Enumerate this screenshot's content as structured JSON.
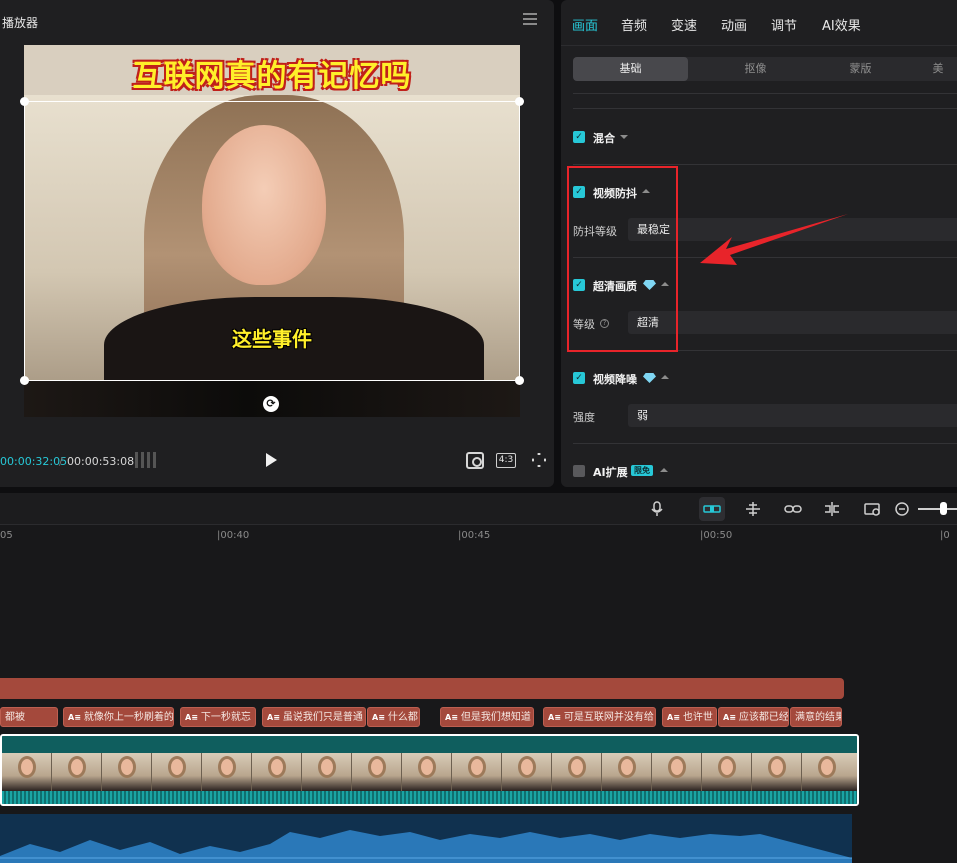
{
  "player": {
    "title": "播放器",
    "overlay_title": "互联网真的有记忆吗",
    "overlay_subtitle": "这些事件",
    "time_current": "00:00:32:05",
    "time_separator": "/",
    "time_total": "00:00:53:08",
    "ratio_label": "4:3"
  },
  "inspector": {
    "tabs": [
      "画面",
      "音频",
      "变速",
      "动画",
      "调节",
      "AI效果"
    ],
    "active_tab": "画面",
    "subtabs": [
      "基础",
      "抠像",
      "蒙版",
      "美"
    ],
    "sections": {
      "blend": {
        "label": "混合",
        "checked": true
      },
      "stabilize": {
        "label": "视频防抖",
        "checked": true,
        "row_label": "防抖等级",
        "row_value": "最稳定"
      },
      "superres": {
        "label": "超清画质",
        "checked": true,
        "row_label": "等级",
        "row_value": "超清"
      },
      "denoise": {
        "label": "视频降噪",
        "checked": true,
        "row_label": "强度",
        "row_value": "弱"
      },
      "ai_expand": {
        "label": "AI扩展",
        "checked": false,
        "badge": "限免"
      }
    },
    "annotation_color": "#e8242a",
    "accent_color": "#27c8d7"
  },
  "timeline": {
    "ruler_labels": [
      "05",
      "|00:40",
      "|00:45",
      "|00:50",
      "|0"
    ],
    "captions": [
      "都被",
      "就像你上一秒刷着的",
      "下一秒就忘",
      "虽说我们只是普通",
      "什么都",
      "但是我们想知道",
      "可是互联网并没有给",
      "也许世",
      "应该都已经",
      "满意的结果"
    ],
    "caption_icon": "A≡"
  }
}
